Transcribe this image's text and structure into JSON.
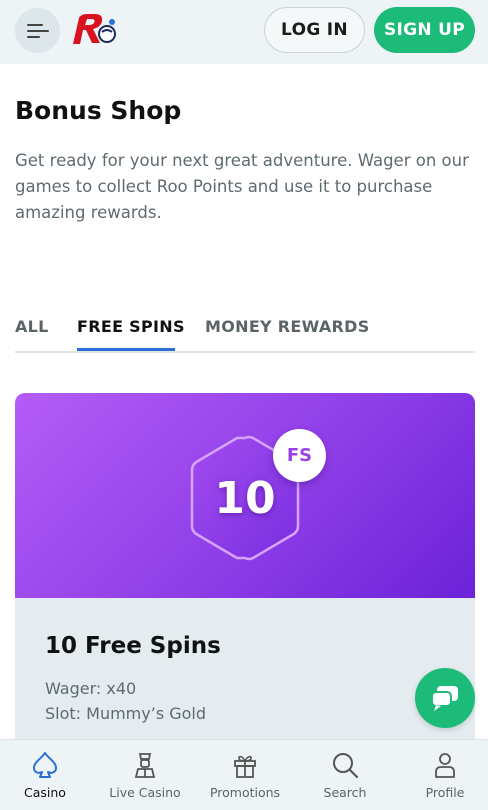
{
  "header": {
    "login_label": "LOG IN",
    "signup_label": "SIGN UP",
    "brand_color": "#d8121f",
    "accent_color": "#1dbb7a"
  },
  "page": {
    "title": "Bonus Shop",
    "intro": "Get ready for your next great adventure. Wager on our games to collect Roo Points and use it to purchase amazing rewards."
  },
  "tabs": [
    {
      "label": "ALL",
      "active": false
    },
    {
      "label": "FREE SPINS",
      "active": true
    },
    {
      "label": "MONEY REWARDS",
      "active": false
    }
  ],
  "card": {
    "number": "10",
    "badge": "FS",
    "title": "10 Free Spins",
    "wager": "Wager: x40",
    "slot": "Slot: Mummy’s Gold"
  },
  "bottom_nav": [
    {
      "label": "Casino",
      "icon": "spade-icon",
      "active": true
    },
    {
      "label": "Live Casino",
      "icon": "dealer-icon",
      "active": false
    },
    {
      "label": "Promotions",
      "icon": "gift-icon",
      "active": false
    },
    {
      "label": "Search",
      "icon": "search-icon",
      "active": false
    },
    {
      "label": "Profile",
      "icon": "profile-icon",
      "active": false
    }
  ]
}
